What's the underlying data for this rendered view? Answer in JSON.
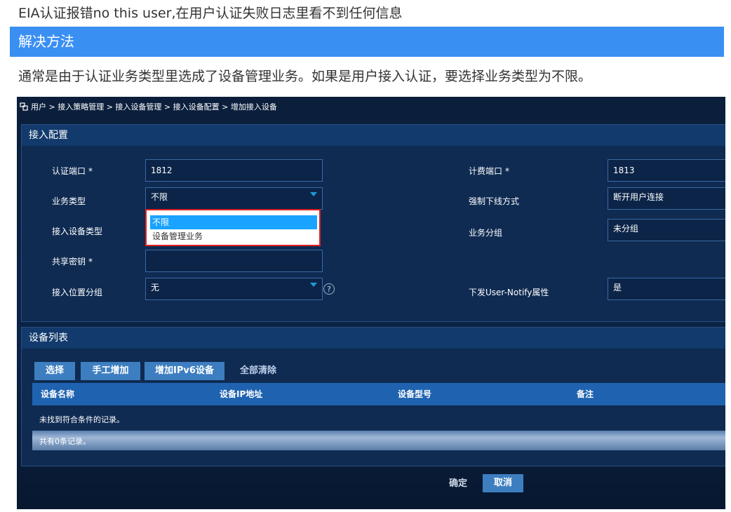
{
  "doc": {
    "title": "EIA认证报错no this user,在用户认证失败日志里看不到任何信息",
    "section": "解决方法",
    "paragraph": "通常是由于认证业务类型里选成了设备管理业务。如果是用户接入认证，要选择业务类型为不限。"
  },
  "breadcrumb": "用户 > 接入策略管理 > 接入设备管理 > 接入设备配置 > 增加接入设备",
  "config": {
    "title": "接入配置",
    "auth_port_label": "认证端口",
    "auth_port": "1812",
    "acct_port_label": "计费端口",
    "acct_port": "1813",
    "service_type_label": "业务类型",
    "service_type": "不限",
    "force_offline_label": "强制下线方式",
    "force_offline": "断开用户连接",
    "device_type_label": "接入设备类型",
    "service_group_label": "业务分组",
    "service_group": "未分组",
    "shared_key_label": "共享密钥",
    "location_group_label": "接入位置分组",
    "location_group": "无",
    "notify_label": "下发User-Notify属性",
    "notify": "是",
    "required_mark": "*",
    "help": "?"
  },
  "dropdown": {
    "options": [
      "不限",
      "设备管理业务"
    ],
    "selected_index": 0
  },
  "devices": {
    "title": "设备列表",
    "buttons": {
      "select": "选择",
      "manual_add": "手工增加",
      "add_ipv6": "增加IPv6设备",
      "clear_all": "全部清除"
    },
    "columns": [
      "设备名称",
      "设备IP地址",
      "设备型号",
      "备注"
    ],
    "empty_text": "未找到符合条件的记录。",
    "total_text": "共有0条记录。"
  },
  "actions": {
    "ok": "确定",
    "cancel": "取消"
  },
  "colors": {
    "banner": "#3a8ff3",
    "selected_option": "#1aa3ff",
    "highlight_border": "#e02020"
  }
}
